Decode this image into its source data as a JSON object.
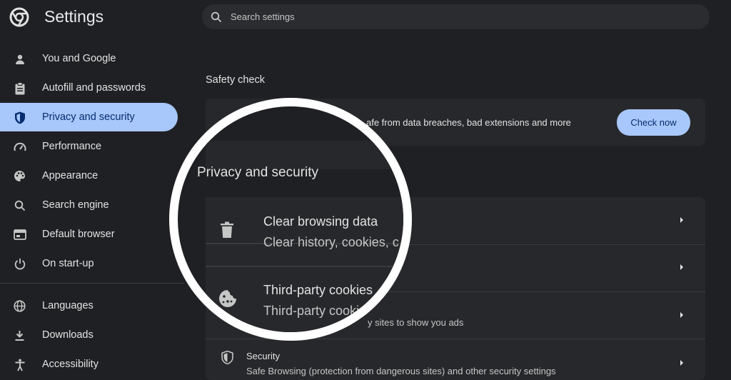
{
  "header": {
    "title": "Settings",
    "logo": "chrome-logo-icon"
  },
  "search": {
    "placeholder": "Search settings",
    "icon": "search-icon"
  },
  "sidebar": {
    "items": [
      {
        "label": "You and Google",
        "icon": "person-icon"
      },
      {
        "label": "Autofill and passwords",
        "icon": "clipboard-icon"
      },
      {
        "label": "Privacy and security",
        "icon": "shield-icon",
        "active": true
      },
      {
        "label": "Performance",
        "icon": "speedometer-icon"
      },
      {
        "label": "Appearance",
        "icon": "palette-icon"
      },
      {
        "label": "Search engine",
        "icon": "search-icon"
      },
      {
        "label": "Default browser",
        "icon": "browser-window-icon"
      },
      {
        "label": "On start-up",
        "icon": "power-icon"
      },
      {
        "label": "Languages",
        "icon": "globe-icon"
      },
      {
        "label": "Downloads",
        "icon": "download-icon"
      },
      {
        "label": "Accessibility",
        "icon": "accessibility-icon"
      }
    ]
  },
  "safety_check": {
    "title": "Safety check",
    "description": "afe from data breaches, bad extensions and more",
    "button": "Check now"
  },
  "privacy": {
    "title": "Privacy and security",
    "rows": [
      {
        "title": "Clear browsing data",
        "subtitle": "Clear history, cookies, c",
        "icon": "trash-icon"
      },
      {
        "title": "Third-party cookies",
        "subtitle": "Third-party cooki",
        "icon": "cookie-icon"
      },
      {
        "subtitle_tail": "y sites to show you ads"
      },
      {
        "title": "Security",
        "subtitle": "Safe Browsing (protection from dangerous sites) and other security settings",
        "icon": "security-shield-icon"
      }
    ]
  },
  "colors": {
    "background": "#1f2023",
    "card": "#27282b",
    "accent": "#a8c7fa",
    "accent_text": "#062e6f",
    "magnifier_ring": "#ffffff"
  }
}
